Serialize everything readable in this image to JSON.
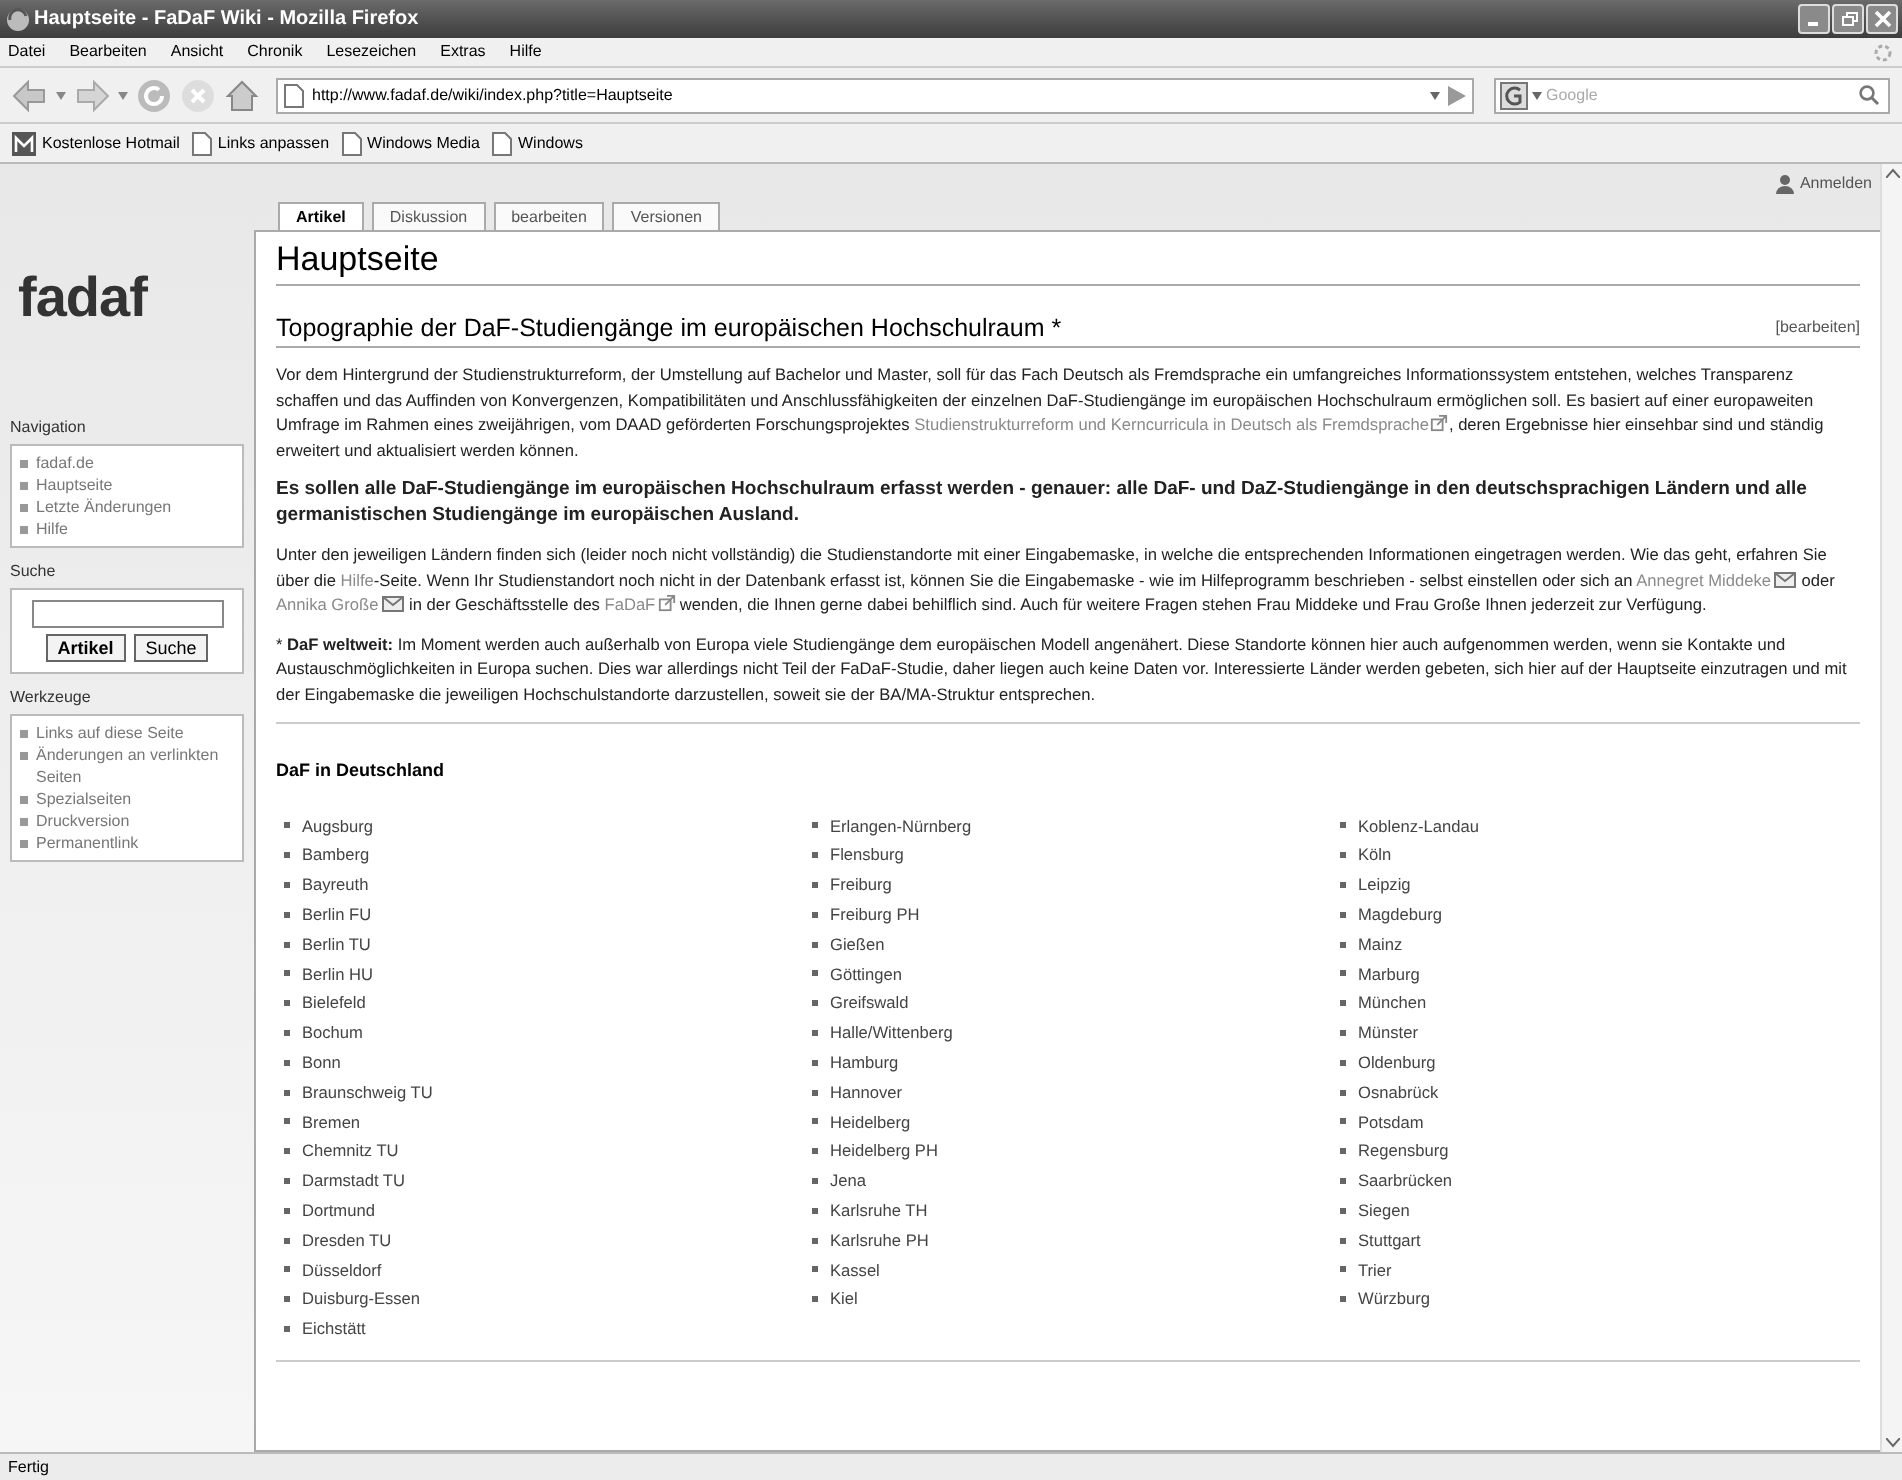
{
  "window": {
    "title": "Hauptseite - FaDaF Wiki - Mozilla Firefox"
  },
  "menu": [
    "Datei",
    "Bearbeiten",
    "Ansicht",
    "Chronik",
    "Lesezeichen",
    "Extras",
    "Hilfe"
  ],
  "address": {
    "value": "http://www.fadaf.de/wiki/index.php?title=Hauptseite"
  },
  "search": {
    "placeholder": "Google"
  },
  "bookmarks": [
    {
      "label": "Kostenlose Hotmail",
      "kind": "hotmail"
    },
    {
      "label": "Links anpassen",
      "kind": "page"
    },
    {
      "label": "Windows Media",
      "kind": "page"
    },
    {
      "label": "Windows",
      "kind": "page"
    }
  ],
  "user_link": "Anmelden",
  "logo": "fadaf",
  "sidebar": [
    {
      "title": "Navigation",
      "kind": "links",
      "items": [
        "fadaf.de",
        "Hauptseite",
        "Letzte Änderungen",
        "Hilfe"
      ]
    },
    {
      "title": "Suche",
      "kind": "search",
      "buttons": [
        "Artikel",
        "Suche"
      ]
    },
    {
      "title": "Werkzeuge",
      "kind": "links",
      "items": [
        "Links auf diese Seite",
        "Änderungen an verlinkten Seiten",
        "Spezialseiten",
        "Druckversion",
        "Permanentlink"
      ]
    }
  ],
  "tabs": [
    {
      "label": "Artikel",
      "selected": true
    },
    {
      "label": "Diskussion",
      "selected": false
    },
    {
      "label": "bearbeiten",
      "selected": false
    },
    {
      "label": "Versionen",
      "selected": false
    }
  ],
  "page_title": "Hauptseite",
  "section": {
    "title": "Topographie der DaF-Studiengänge im europäischen Hochschulraum *",
    "edit": "[bearbeiten]"
  },
  "paragraphs": [
    {
      "bold": false,
      "parts": [
        {
          "kind": "text",
          "text": "Vor dem Hintergrund der Studienstrukturreform, der Umstellung auf Bachelor und Master, soll für das Fach Deutsch als Fremdsprache ein umfangreiches Informationssystem entstehen, welches Transparenz schaffen und das Auffinden von Konvergenzen, Kompatibilitäten und Anschlussfähigkeiten der einzelnen DaF-Studiengänge im europäischen Hochschulraum ermöglichen soll. Es basiert auf einer europaweiten Umfrage im Rahmen eines zweijährigen, vom DAAD geförderten Forschungsprojektes "
        },
        {
          "kind": "external",
          "text": "Studienstrukturreform und Kerncurricula in Deutsch als Fremdsprache"
        },
        {
          "kind": "text",
          "text": ", deren Ergebnisse hier einsehbar sind und ständig erweitert und aktualisiert werden können."
        }
      ]
    },
    {
      "bold": true,
      "parts": [
        {
          "kind": "text",
          "text": "Es sollen alle DaF-Studiengänge im europäischen Hochschulraum erfasst werden - genauer: alle DaF- und DaZ-Studiengänge in den deutschsprachigen Ländern und alle germanistischen Studiengänge im europäischen Ausland."
        }
      ]
    },
    {
      "bold": false,
      "parts": [
        {
          "kind": "text",
          "text": "Unter den jeweiligen Ländern finden sich (leider noch nicht vollständig) die Studienstandorte mit einer Eingabemaske, in welche die entsprechenden Informationen eingetragen werden. Wie das geht, erfahren Sie über die "
        },
        {
          "kind": "link",
          "text": "Hilfe"
        },
        {
          "kind": "text",
          "text": "-Seite. Wenn Ihr Studienstandort noch nicht in der Datenbank erfasst ist, können Sie die Eingabemaske - wie im Hilfeprogramm beschrieben - selbst einstellen oder sich an "
        },
        {
          "kind": "mail",
          "text": "Annegret Middeke"
        },
        {
          "kind": "text",
          "text": " oder "
        },
        {
          "kind": "mail",
          "text": "Annika Große"
        },
        {
          "kind": "text",
          "text": " in der Geschäftsstelle des "
        },
        {
          "kind": "external",
          "text": "FaDaF"
        },
        {
          "kind": "text",
          "text": " wenden, die Ihnen gerne dabei behilflich sind. Auch für weitere Fragen stehen Frau Middeke und Frau Große Ihnen jederzeit zur Verfügung."
        }
      ]
    },
    {
      "bold": false,
      "parts": [
        {
          "kind": "text",
          "text": "* **DaF weltweit:** Im Moment werden auch außerhalb von Europa viele Studiengänge dem europäischen Modell angenähert. Diese Standorte können hier auch aufgenommen werden, wenn sie Kontakte und Austauschmöglichkeiten in Europa suchen. Dies war allerdings nicht Teil der FaDaF-Studie, daher liegen auch keine Daten vor. Interessierte Länder werden gebeten, sich hier auf der Hauptseite einzutragen und mit der Eingabemaske die jeweiligen Hochschulstandorte darzustellen, soweit sie der BA/MA-Struktur entsprechen."
        }
      ]
    }
  ],
  "list_title": "DaF in Deutschland",
  "columns": [
    [
      "Augsburg",
      "Bamberg",
      "Bayreuth",
      "Berlin FU",
      "Berlin TU",
      "Berlin HU",
      "Bielefeld",
      "Bochum",
      "Bonn",
      "Braunschweig TU",
      "Bremen",
      "Chemnitz TU",
      "Darmstadt TU",
      "Dortmund",
      "Dresden TU",
      "Düsseldorf",
      "Duisburg-Essen",
      "Eichstätt"
    ],
    [
      "Erlangen-Nürnberg",
      "Flensburg",
      "Freiburg",
      "Freiburg PH",
      "Gießen",
      "Göttingen",
      "Greifswald",
      "Halle/Wittenberg",
      "Hamburg",
      "Hannover",
      "Heidelberg",
      "Heidelberg PH",
      "Jena",
      "Karlsruhe TH",
      "Karlsruhe PH",
      "Kassel",
      "Kiel"
    ],
    [
      "Koblenz-Landau",
      "Köln",
      "Leipzig",
      "Magdeburg",
      "Mainz",
      "Marburg",
      "München",
      "Münster",
      "Oldenburg",
      "Osnabrück",
      "Potsdam",
      "Regensburg",
      "Saarbrücken",
      "Siegen",
      "Stuttgart",
      "Trier",
      "Würzburg"
    ]
  ],
  "status": "Fertig"
}
